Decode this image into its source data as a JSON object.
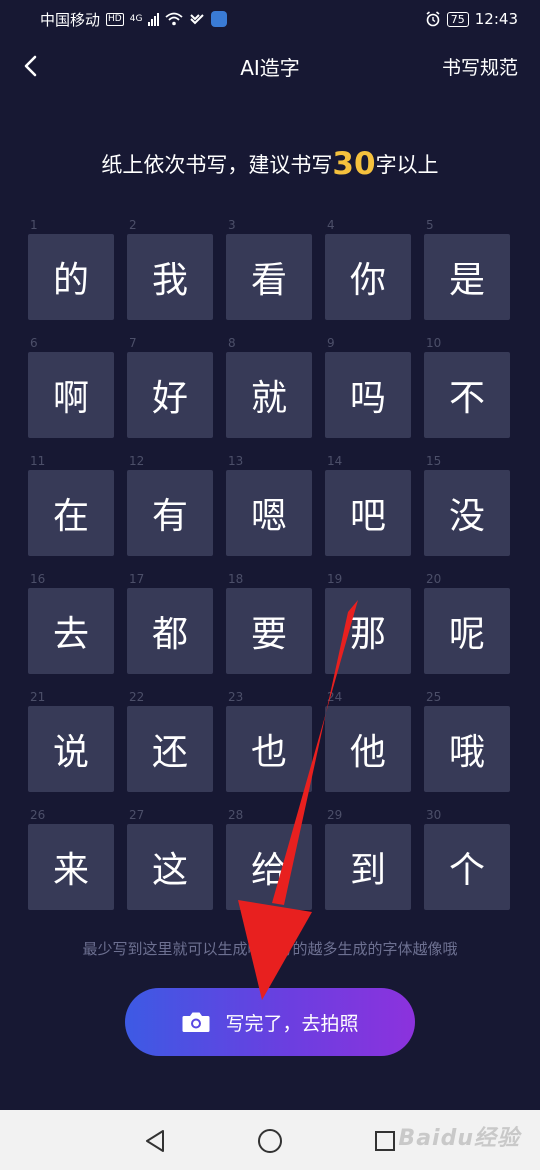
{
  "status_bar": {
    "carrier": "中国移动",
    "hd": "HD",
    "network": "4G",
    "battery": "75",
    "time": "12:43"
  },
  "nav": {
    "title": "AI造字",
    "rules": "书写规范"
  },
  "instruction": {
    "prefix": "纸上依次书写，建议书写",
    "count": "30",
    "suffix": "字以上"
  },
  "characters": [
    {
      "num": "1",
      "char": "的"
    },
    {
      "num": "2",
      "char": "我"
    },
    {
      "num": "3",
      "char": "看"
    },
    {
      "num": "4",
      "char": "你"
    },
    {
      "num": "5",
      "char": "是"
    },
    {
      "num": "6",
      "char": "啊"
    },
    {
      "num": "7",
      "char": "好"
    },
    {
      "num": "8",
      "char": "就"
    },
    {
      "num": "9",
      "char": "吗"
    },
    {
      "num": "10",
      "char": "不"
    },
    {
      "num": "11",
      "char": "在"
    },
    {
      "num": "12",
      "char": "有"
    },
    {
      "num": "13",
      "char": "嗯"
    },
    {
      "num": "14",
      "char": "吧"
    },
    {
      "num": "15",
      "char": "没"
    },
    {
      "num": "16",
      "char": "去"
    },
    {
      "num": "17",
      "char": "都"
    },
    {
      "num": "18",
      "char": "要"
    },
    {
      "num": "19",
      "char": "那"
    },
    {
      "num": "20",
      "char": "呢"
    },
    {
      "num": "21",
      "char": "说"
    },
    {
      "num": "22",
      "char": "还"
    },
    {
      "num": "23",
      "char": "也"
    },
    {
      "num": "24",
      "char": "他"
    },
    {
      "num": "25",
      "char": "哦"
    },
    {
      "num": "26",
      "char": "来"
    },
    {
      "num": "27",
      "char": "这"
    },
    {
      "num": "28",
      "char": "给"
    },
    {
      "num": "29",
      "char": "到"
    },
    {
      "num": "30",
      "char": "个"
    }
  ],
  "hint": "最少写到这里就可以生成啦，写的越多生成的字体越像哦",
  "capture_button": {
    "label": "写完了，去拍照",
    "icon": "camera-icon"
  },
  "watermark": "Baidu经验",
  "colors": {
    "background": "#171833",
    "cell": "#373a57",
    "highlight": "#f5c13d",
    "button_start": "#3d5ae4",
    "button_end": "#8c32dd",
    "arrow": "#e8201f"
  }
}
